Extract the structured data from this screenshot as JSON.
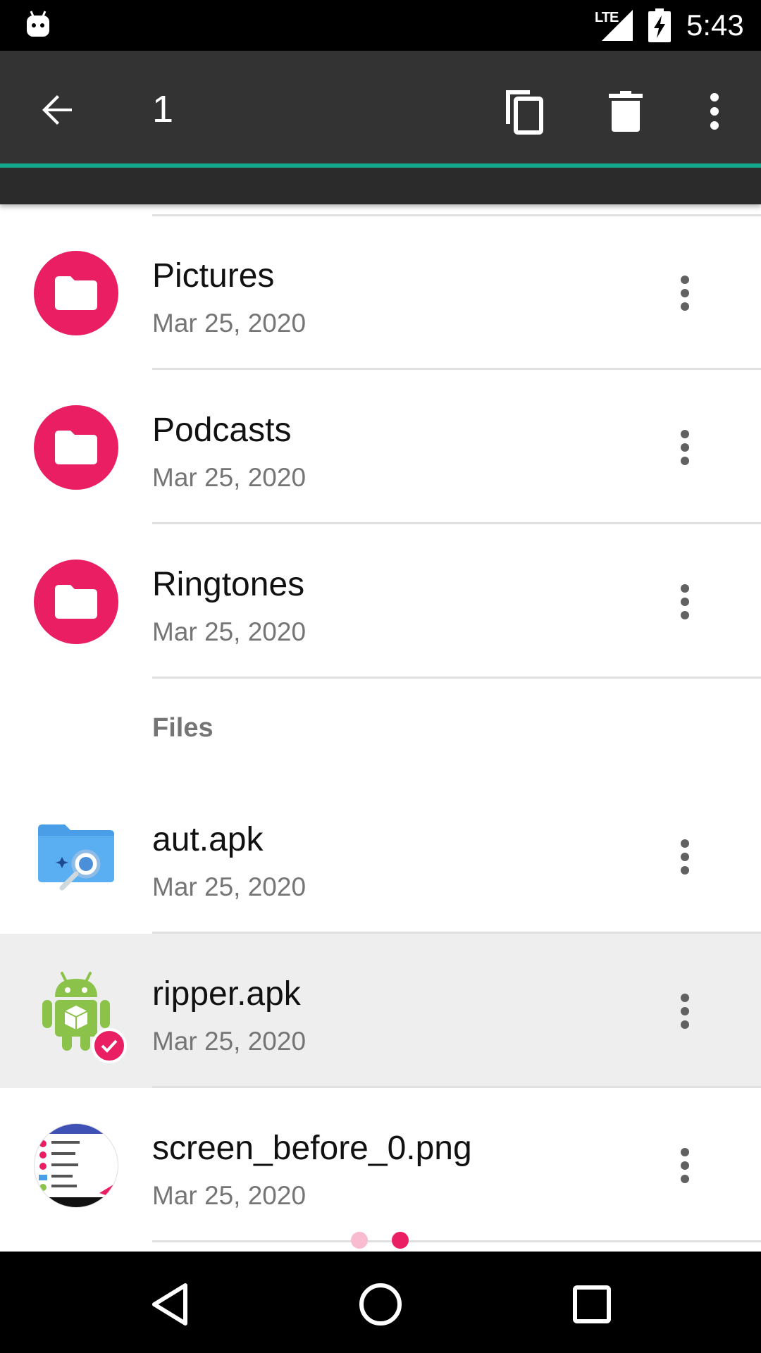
{
  "status_bar": {
    "network": "LTE",
    "time": "5:43"
  },
  "toolbar": {
    "selection_count": "1",
    "accent_color": "#13a98e"
  },
  "folders": [
    {
      "name": "Pictures",
      "date": "Mar 25, 2020",
      "icon": "folder-icon"
    },
    {
      "name": "Podcasts",
      "date": "Mar 25, 2020",
      "icon": "folder-icon"
    },
    {
      "name": "Ringtones",
      "date": "Mar 25, 2020",
      "icon": "folder-icon"
    }
  ],
  "files_header": "Files",
  "files": [
    {
      "name": "aut.apk",
      "date": "Mar 25, 2020",
      "icon": "files-app-icon",
      "selected": false
    },
    {
      "name": "ripper.apk",
      "date": "Mar 25, 2020",
      "icon": "android-icon",
      "selected": true
    },
    {
      "name": "screen_before_0.png",
      "date": "Mar 25, 2020",
      "icon": "image-thumbnail",
      "selected": false
    }
  ],
  "colors": {
    "accent": "#e91e63",
    "selected_row": "#eeeeee"
  },
  "page_indicator": {
    "pages": 2,
    "current": 2
  }
}
